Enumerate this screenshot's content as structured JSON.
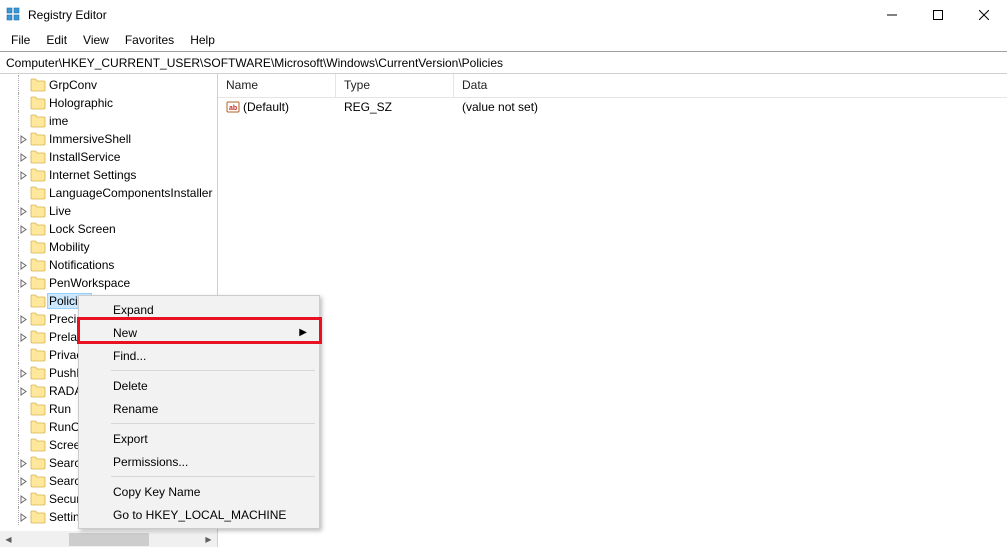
{
  "window": {
    "title": "Registry Editor"
  },
  "menubar": [
    "File",
    "Edit",
    "View",
    "Favorites",
    "Help"
  ],
  "address": "Computer\\HKEY_CURRENT_USER\\SOFTWARE\\Microsoft\\Windows\\CurrentVersion\\Policies",
  "tree_items": [
    {
      "label": "GrpConv",
      "expandable": false
    },
    {
      "label": "Holographic",
      "expandable": false
    },
    {
      "label": "ime",
      "expandable": false
    },
    {
      "label": "ImmersiveShell",
      "expandable": true
    },
    {
      "label": "InstallService",
      "expandable": true
    },
    {
      "label": "Internet Settings",
      "expandable": true
    },
    {
      "label": "LanguageComponentsInstaller",
      "expandable": false
    },
    {
      "label": "Live",
      "expandable": true
    },
    {
      "label": "Lock Screen",
      "expandable": true
    },
    {
      "label": "Mobility",
      "expandable": false
    },
    {
      "label": "Notifications",
      "expandable": true
    },
    {
      "label": "PenWorkspace",
      "expandable": true
    },
    {
      "label": "Policies",
      "expandable": false,
      "selected": true
    },
    {
      "label": "Precis",
      "expandable": true,
      "truncated": true
    },
    {
      "label": "Prelau",
      "expandable": true,
      "truncated": true
    },
    {
      "label": "Privacy",
      "expandable": false,
      "truncated": true
    },
    {
      "label": "PushN",
      "expandable": true,
      "truncated": true
    },
    {
      "label": "RADA",
      "expandable": true,
      "truncated": true
    },
    {
      "label": "Run",
      "expandable": false
    },
    {
      "label": "RunOn",
      "expandable": false,
      "truncated": true
    },
    {
      "label": "Screen",
      "expandable": false,
      "truncated": true
    },
    {
      "label": "Search",
      "expandable": true,
      "truncated": true
    },
    {
      "label": "Search",
      "expandable": true,
      "truncated": true
    },
    {
      "label": "Securi",
      "expandable": true,
      "truncated": true
    },
    {
      "label": "Setting",
      "expandable": true,
      "truncated": true
    }
  ],
  "list": {
    "columns": {
      "name": "Name",
      "type": "Type",
      "data": "Data"
    },
    "rows": [
      {
        "name": "(Default)",
        "type": "REG_SZ",
        "data": "(value not set)"
      }
    ]
  },
  "context_menu": {
    "items": [
      {
        "label": "Expand"
      },
      {
        "label": "New",
        "submenu": true,
        "highlighted": true
      },
      {
        "label": "Find..."
      },
      {
        "sep": true
      },
      {
        "label": "Delete"
      },
      {
        "label": "Rename"
      },
      {
        "sep": true
      },
      {
        "label": "Export"
      },
      {
        "label": "Permissions..."
      },
      {
        "sep": true
      },
      {
        "label": "Copy Key Name"
      },
      {
        "label": "Go to HKEY_LOCAL_MACHINE"
      }
    ]
  }
}
